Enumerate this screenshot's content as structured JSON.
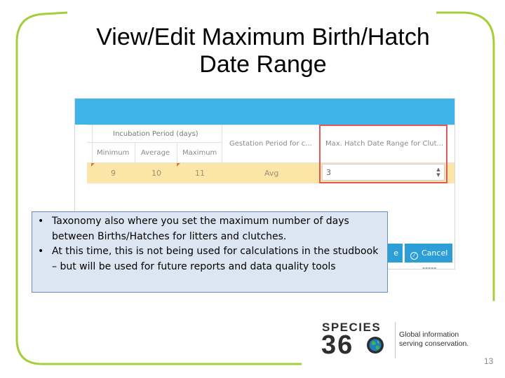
{
  "slide": {
    "title_lines": [
      "View/Edit Maximum Birth/Hatch",
      "Date Range"
    ],
    "page_number": "13",
    "frame_color": "#a6ce39"
  },
  "screenshot": {
    "header_bar_color": "#3fb4e6",
    "incubation_group_label": "Incubation Period (days)",
    "col_minimum": "Minimum",
    "col_average": "Average",
    "col_maximum": "Maximum",
    "col_gestation": "Gestation Period for c...",
    "col_max_hatch": "Max. Hatch Date Range for Clut...",
    "row": {
      "minimum": "9",
      "average": "10",
      "maximum": "11",
      "gestation": "Avg",
      "max_hatch_value": "3"
    },
    "save_label": "e",
    "cancel_label": "Cancel",
    "highlight_color": "#e05a5a",
    "row_color": "#fbe6a8"
  },
  "callout": {
    "bullets": [
      "Taxonomy also where you set the maximum number of days between Births/Hatches for litters and clutches.",
      "At this time, this is not being used for calculations in the studbook – but will be used for future reports and data quality tools"
    ]
  },
  "logo": {
    "brand_word": "SPECIES",
    "brand_number": "36",
    "tagline_lines": [
      "Global information",
      "serving conservation."
    ],
    "globe_icon": "globe-icon"
  }
}
